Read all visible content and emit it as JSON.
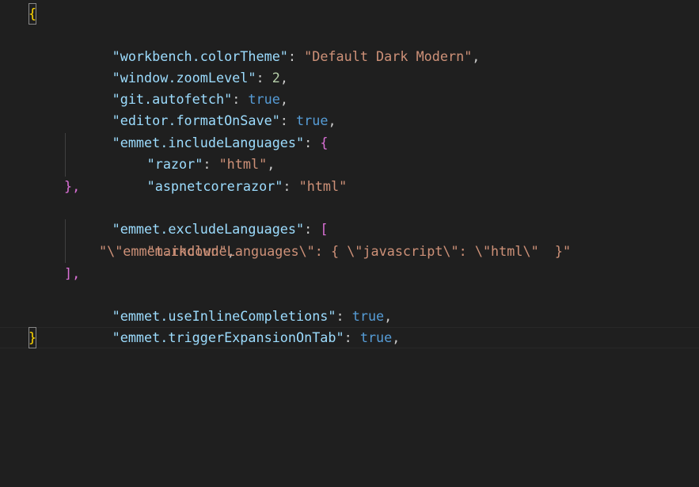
{
  "editor": {
    "open_brace": "{",
    "close_brace": "}",
    "settings": [
      {
        "key": "\"workbench.colorTheme\"",
        "value": "\"Default Dark Modern\"",
        "value_type": "string"
      },
      {
        "key": "\"window.zoomLevel\"",
        "value": "2",
        "value_type": "number"
      },
      {
        "key": "\"git.autofetch\"",
        "value": "true",
        "value_type": "boolean"
      },
      {
        "key": "\"editor.formatOnSave\"",
        "value": "true",
        "value_type": "boolean"
      },
      {
        "key": "\"emmet.includeLanguages\"",
        "open": "{",
        "entries": [
          {
            "key": "\"razor\"",
            "value": "\"html\""
          },
          {
            "key": "\"aspnetcorerazor\"",
            "value": "\"html\""
          }
        ],
        "close": "},"
      },
      {
        "key": "\"emmet.excludeLanguages\"",
        "open": "[",
        "items": [
          "\"markdown\"",
          "\"\\\"emmet.includeLanguages\\\": { \\\"javascript\\\": \\\"html\\\"  }\""
        ],
        "close": "],"
      },
      {
        "key": "\"emmet.useInlineCompletions\"",
        "value": "true",
        "value_type": "boolean"
      },
      {
        "key": "\"emmet.triggerExpansionOnTab\"",
        "value": "true",
        "value_type": "boolean"
      }
    ]
  },
  "colors": {
    "background": "#1f1f1f",
    "property_key": "#9cdcfe",
    "string": "#ce9178",
    "number": "#b5cea8",
    "boolean": "#569cd6",
    "punctuation": "#cccccc",
    "bracket_level_1": "#ffd700",
    "bracket_level_2": "#da70d6",
    "bracket_level_3": "#179fff"
  }
}
